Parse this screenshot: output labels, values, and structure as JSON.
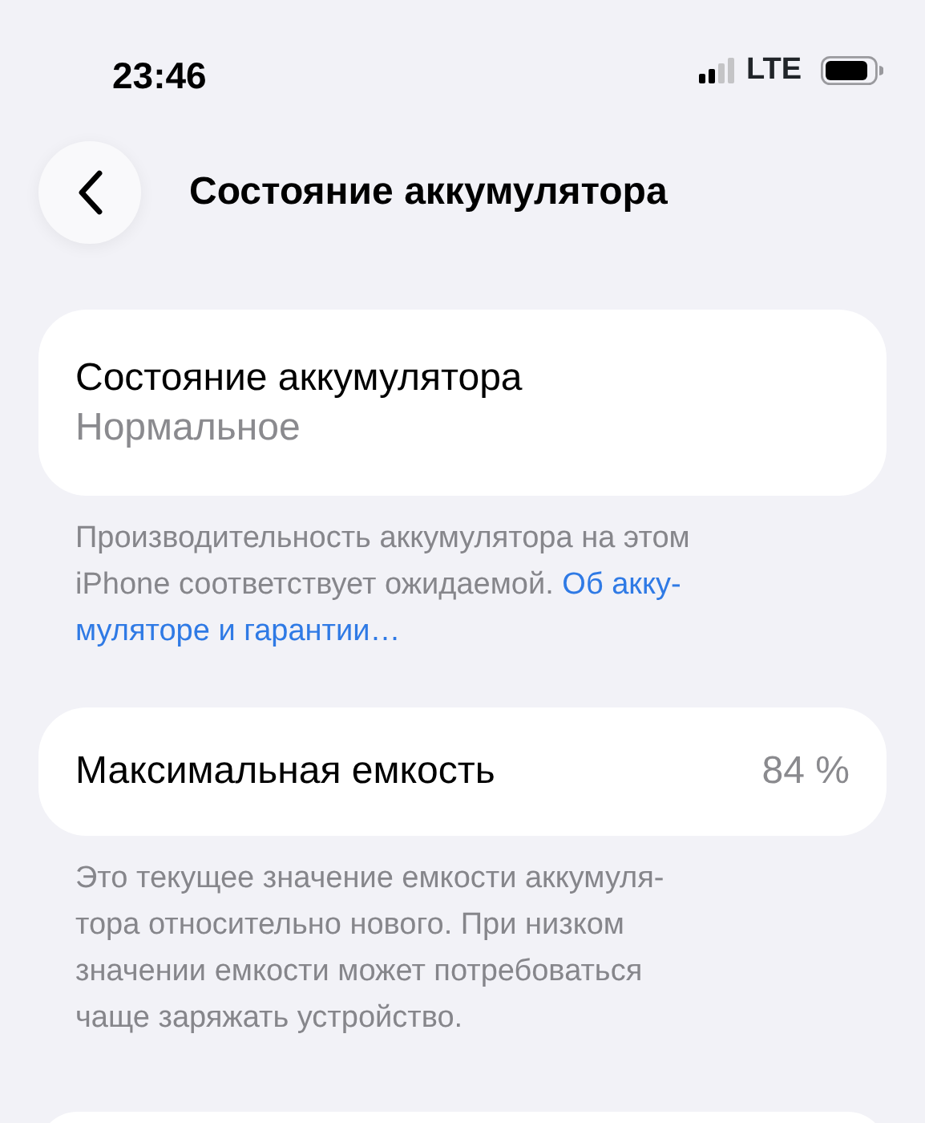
{
  "status_bar": {
    "time": "23:46",
    "network": "LTE"
  },
  "nav": {
    "title": "Состояние аккумулятора"
  },
  "sections": [
    {
      "kind": "stacked",
      "title": "Состояние аккумулятора",
      "value": "Нормальное",
      "footer": "Производительность аккумулятора на этом\niPhone соответствует ожидаемой. ",
      "footer_link_lines": [
        "Об акку-",
        "муляторе и гарантии…"
      ]
    },
    {
      "kind": "inline",
      "title": "Максимальная емкость",
      "value": "84 %",
      "footer": "Это текущее значение емкости аккумуля-\nтора относительно нового. При низком\nзначении емкости может потребоваться\nчаще заряжать устройство."
    },
    {
      "kind": "empty"
    }
  ]
}
